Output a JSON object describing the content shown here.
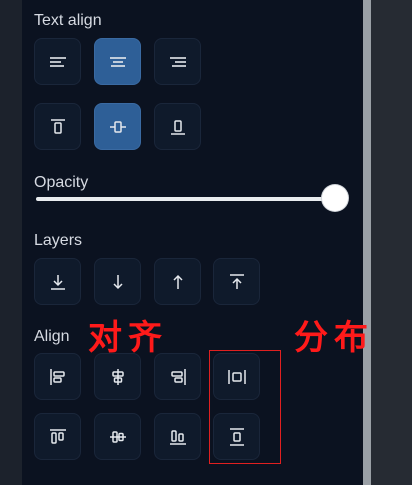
{
  "sections": {
    "text_align": "Text align",
    "opacity": "Opacity",
    "layers": "Layers",
    "align": "Align"
  },
  "opacity_value": 1.0,
  "annotations": {
    "align_cn": "对齐",
    "distribute_cn": "分布"
  },
  "icons": {
    "text_align_row": [
      "align-left-icon",
      "align-center-icon",
      "align-right-icon"
    ],
    "vertical_align_row": [
      "vertical-align-top-icon",
      "vertical-align-middle-icon",
      "vertical-align-bottom-icon"
    ],
    "layers_row": [
      "send-to-back-icon",
      "send-backward-icon",
      "bring-forward-icon",
      "bring-to-front-icon"
    ],
    "align_row_1": [
      "align-left-edges-icon",
      "align-horizontal-centers-icon",
      "align-right-edges-icon",
      "distribute-horizontal-icon"
    ],
    "align_row_2": [
      "align-top-edges-icon",
      "align-vertical-centers-icon",
      "align-bottom-edges-icon",
      "distribute-vertical-icon"
    ]
  },
  "colors": {
    "active": "#2e5f97",
    "panel": "#0b1220",
    "annotation": "#ff1a1a"
  }
}
